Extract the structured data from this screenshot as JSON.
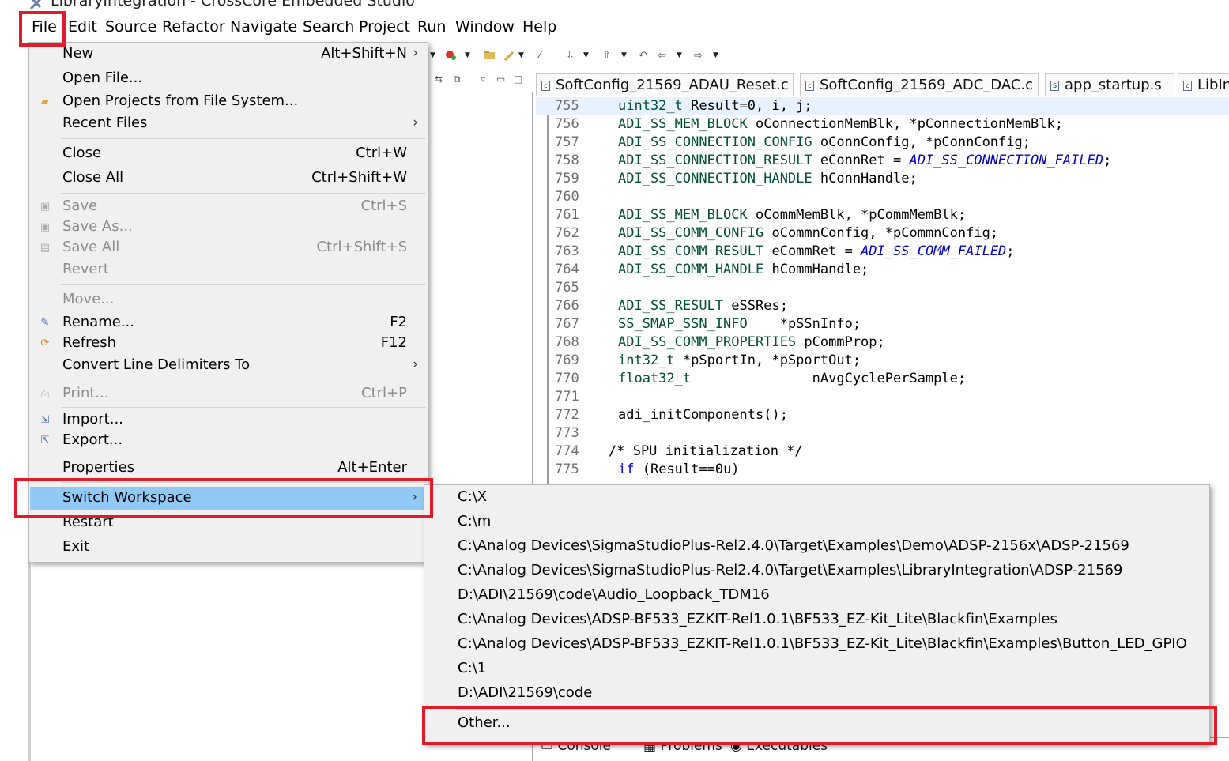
{
  "window": {
    "title": "LibraryIntegration - CrossCore Embedded Studio",
    "app_icon": "tools-icon"
  },
  "menubar": [
    "File",
    "Edit",
    "Source",
    "Refactor",
    "Navigate",
    "Search",
    "Project",
    "Run",
    "Window",
    "Help"
  ],
  "file_menu": {
    "items": [
      {
        "label": "New",
        "shortcut": "Alt+Shift+N",
        "submenu": true
      },
      {
        "label": "Open File..."
      },
      {
        "label": "Open Projects from File System...",
        "icon": "folder-icon"
      },
      {
        "label": "Recent Files",
        "submenu": true
      },
      {
        "label": "Close",
        "shortcut": "Ctrl+W"
      },
      {
        "label": "Close All",
        "shortcut": "Ctrl+Shift+W"
      },
      {
        "label": "Save",
        "shortcut": "Ctrl+S",
        "disabled": true,
        "icon": "save-icon"
      },
      {
        "label": "Save As...",
        "disabled": true,
        "icon": "save-as-icon"
      },
      {
        "label": "Save All",
        "shortcut": "Ctrl+Shift+S",
        "disabled": true,
        "icon": "save-all-icon"
      },
      {
        "label": "Revert",
        "disabled": true
      },
      {
        "label": "Move...",
        "disabled": true
      },
      {
        "label": "Rename...",
        "shortcut": "F2",
        "icon": "rename-icon"
      },
      {
        "label": "Refresh",
        "shortcut": "F12",
        "icon": "refresh-icon"
      },
      {
        "label": "Convert Line Delimiters To",
        "submenu": true
      },
      {
        "label": "Print...",
        "shortcut": "Ctrl+P",
        "disabled": true,
        "icon": "print-icon"
      },
      {
        "label": "Import...",
        "icon": "import-icon"
      },
      {
        "label": "Export...",
        "icon": "export-icon"
      },
      {
        "label": "Properties",
        "shortcut": "Alt+Enter"
      },
      {
        "label": "Switch Workspace",
        "submenu": true,
        "selected": true
      },
      {
        "label": "Restart"
      },
      {
        "label": "Exit"
      }
    ]
  },
  "switch_workspace_menu": {
    "items": [
      "C:\\X",
      "C:\\m",
      "C:\\Analog Devices\\SigmaStudioPlus-Rel2.4.0\\Target\\Examples\\Demo\\ADSP-2156x\\ADSP-21569",
      "C:\\Analog Devices\\SigmaStudioPlus-Rel2.4.0\\Target\\Examples\\LibraryIntegration\\ADSP-21569",
      "D:\\ADI\\21569\\code\\Audio_Loopback_TDM16",
      "C:\\Analog Devices\\ADSP-BF533_EZKIT-Rel1.0.1\\BF533_EZ-Kit_Lite\\Blackfin\\Examples",
      "C:\\Analog Devices\\ADSP-BF533_EZKIT-Rel1.0.1\\BF533_EZ-Kit_Lite\\Blackfin\\Examples\\Button_LED_GPIO",
      "C:\\1",
      "D:\\ADI\\21569\\code"
    ],
    "other": "Other..."
  },
  "editor": {
    "tabs": [
      {
        "label": "SoftConfig_21569_ADAU_Reset.c",
        "icon": "c-file-icon"
      },
      {
        "label": "SoftConfig_21569_ADC_DAC.c",
        "icon": "c-file-icon"
      },
      {
        "label": "app_startup.s",
        "icon": "s-file-icon"
      },
      {
        "label": "LibIn",
        "icon": "c-file-icon"
      }
    ],
    "lines": [
      {
        "n": "755",
        "code": "uint32_t Result=0, i, j;"
      },
      {
        "n": "756",
        "code": "ADI_SS_MEM_BLOCK oConnectionMemBlk, *pConnectionMemBlk;"
      },
      {
        "n": "757",
        "code": "ADI_SS_CONNECTION_CONFIG oConnConfig, *pConnConfig;"
      },
      {
        "n": "758",
        "code": "ADI_SS_CONNECTION_RESULT eConnRet = ADI_SS_CONNECTION_FAILED;"
      },
      {
        "n": "759",
        "code": "ADI_SS_CONNECTION_HANDLE hConnHandle;"
      },
      {
        "n": "760",
        "code": ""
      },
      {
        "n": "761",
        "code": "ADI_SS_MEM_BLOCK oCommMemBlk, *pCommMemBlk;"
      },
      {
        "n": "762",
        "code": "ADI_SS_COMM_CONFIG oCommnConfig, *pCommnConfig;"
      },
      {
        "n": "763",
        "code": "ADI_SS_COMM_RESULT eCommRet = ADI_SS_COMM_FAILED;"
      },
      {
        "n": "764",
        "code": "ADI_SS_COMM_HANDLE hCommHandle;"
      },
      {
        "n": "765",
        "code": ""
      },
      {
        "n": "766",
        "code": "ADI_SS_RESULT eSSRes;"
      },
      {
        "n": "767",
        "code": "SS_SMAP_SSN_INFO    *pSSnInfo;"
      },
      {
        "n": "768",
        "code": "ADI_SS_COMM_PROPERTIES pCommProp;"
      },
      {
        "n": "769",
        "code": "int32_t *pSportIn, *pSportOut;"
      },
      {
        "n": "770",
        "code": "float32_t               nAvgCyclePerSample;"
      },
      {
        "n": "771",
        "code": ""
      },
      {
        "n": "772",
        "code": "adi_initComponents();"
      },
      {
        "n": "773",
        "code": ""
      },
      {
        "n": "774",
        "code": "/* SPU initialization */"
      },
      {
        "n": "775",
        "code": "if (Result==0u)"
      }
    ]
  },
  "bottom_tabs": [
    "Console",
    "Problems",
    "Executables"
  ],
  "colors": {
    "highlight": "#91c9f7",
    "annotation": "#e21c26",
    "menu_bg": "#f0f0f0"
  }
}
